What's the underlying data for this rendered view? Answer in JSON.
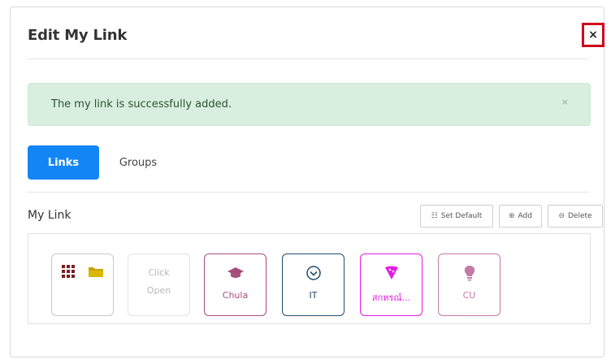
{
  "modal": {
    "title": "Edit My Link",
    "close_label": "×"
  },
  "alert": {
    "message": "The my link is successfully added.",
    "close_label": "×",
    "color": "#d8efdf"
  },
  "tabs": [
    {
      "label": "Links",
      "active": true
    },
    {
      "label": "Groups",
      "active": false
    }
  ],
  "section": {
    "title": "My Link",
    "buttons": [
      {
        "label": "Set Default",
        "icon": "list-icon"
      },
      {
        "label": "Add",
        "icon": "plus-circle-icon"
      },
      {
        "label": "Delete",
        "icon": "minus-circle-icon"
      }
    ]
  },
  "links": {
    "toolbox": {
      "icons": [
        "grid-icon",
        "folder-icon"
      ]
    },
    "placeholder": {
      "line1": "Click",
      "line2": "Open"
    },
    "items": [
      {
        "label": "Chula",
        "icon": "graduation-cap-icon",
        "color": "#a64d79"
      },
      {
        "label": "IT",
        "icon": "chevron-circle-down-icon",
        "color": "#234c6c"
      },
      {
        "label": "สกหรณ์...",
        "icon": "pizza-slice-icon",
        "color": "#e61ce6"
      },
      {
        "label": "CU",
        "icon": "lightbulb-icon",
        "color": "#c47aa6"
      }
    ]
  },
  "colors": {
    "primary": "#1485f5",
    "close_highlight": "#d0021b"
  }
}
